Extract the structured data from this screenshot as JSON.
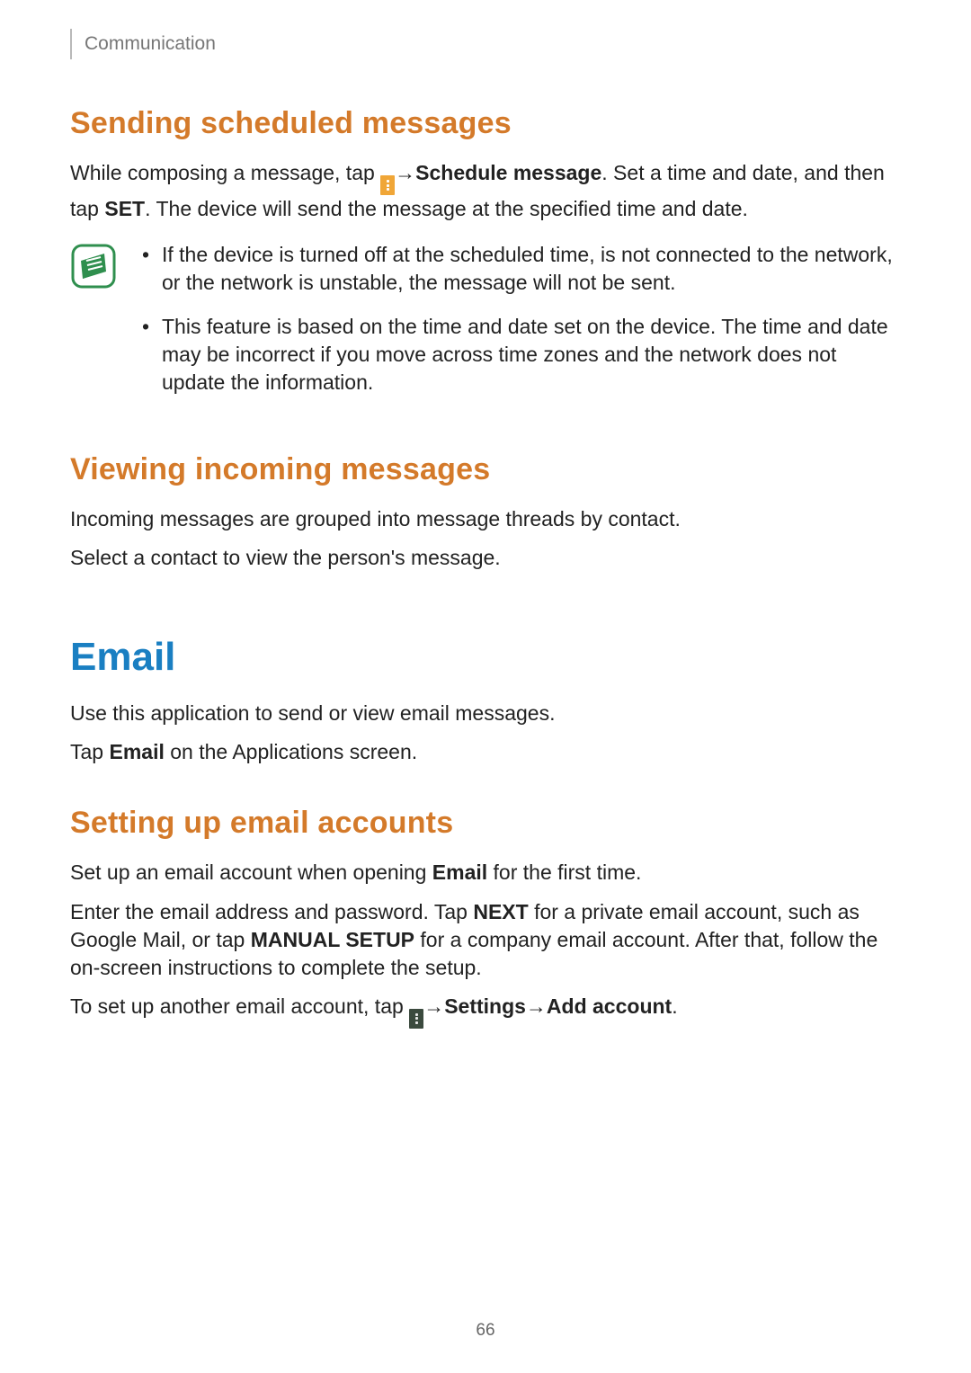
{
  "header": {
    "chapter": "Communication"
  },
  "s1": {
    "heading": "Sending scheduled messages",
    "p1a": "While composing a message, tap ",
    "p1b": " → ",
    "p1c": "Schedule message",
    "p1d": ". Set a time and date, and then tap ",
    "p1e": "SET",
    "p1f": ". The device will send the message at the specified time and date.",
    "notes": [
      "If the device is turned off at the scheduled time, is not connected to the network, or the network is unstable, the message will not be sent.",
      "This feature is based on the time and date set on the device. The time and date may be incorrect if you move across time zones and the network does not update the information."
    ]
  },
  "s2": {
    "heading": "Viewing incoming messages",
    "p1": "Incoming messages are grouped into message threads by contact.",
    "p2": "Select a contact to view the person's message."
  },
  "s3": {
    "heading": "Email",
    "p1": "Use this application to send or view email messages.",
    "p2a": "Tap ",
    "p2b": "Email",
    "p2c": " on the Applications screen."
  },
  "s4": {
    "heading": "Setting up email accounts",
    "p1a": "Set up an email account when opening ",
    "p1b": "Email",
    "p1c": " for the first time.",
    "p2a": "Enter the email address and password. Tap ",
    "p2b": "NEXT",
    "p2c": " for a private email account, such as Google Mail, or tap ",
    "p2d": "MANUAL SETUP",
    "p2e": " for a company email account. After that, follow the on-screen instructions to complete the setup.",
    "p3a": "To set up another email account, tap ",
    "p3b": " → ",
    "p3c": "Settings",
    "p3d": " → ",
    "p3e": "Add account",
    "p3f": "."
  },
  "page_number": "66"
}
